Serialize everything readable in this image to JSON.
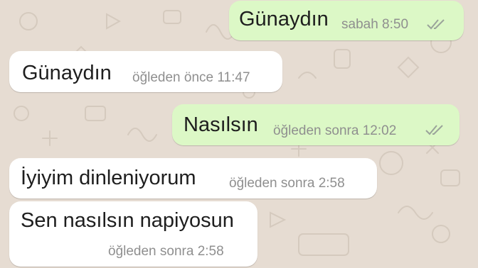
{
  "colors": {
    "outgoing_bubble": "#dcf8c6",
    "incoming_bubble": "#ffffff",
    "wallpaper": "#e6dcd2",
    "timestamp": "#8f8f8f",
    "tick": "#9aa39a"
  },
  "messages": [
    {
      "direction": "outgoing",
      "text": "Günaydın",
      "time": "sabah 8:50",
      "status_icon": "double-check-icon"
    },
    {
      "direction": "incoming",
      "text": "Günaydın",
      "time": "öğleden önce 11:47"
    },
    {
      "direction": "outgoing",
      "text": "Nasılsın",
      "time": "öğleden sonra 12:02",
      "status_icon": "double-check-icon"
    },
    {
      "direction": "incoming",
      "text": "İyiyim dinleniyorum",
      "time": "öğleden sonra 2:58"
    },
    {
      "direction": "incoming",
      "text": "Sen nasılsın napiyosun",
      "time": "öğleden sonra 2:58"
    }
  ]
}
